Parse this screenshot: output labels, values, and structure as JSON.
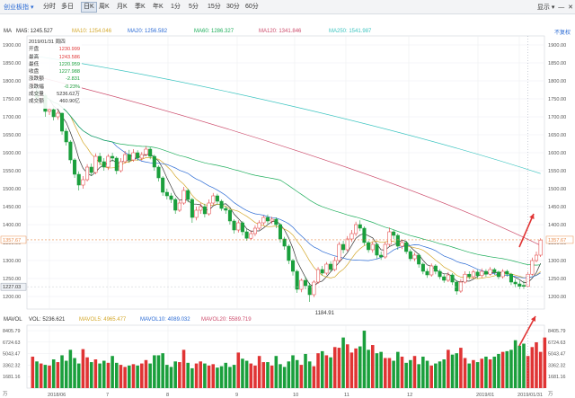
{
  "toolbar": {
    "title": "创业板指",
    "periods": [
      "分时",
      "多日",
      "日K",
      "周K",
      "月K",
      "季K",
      "年K",
      "1分",
      "5分",
      "15分",
      "30分",
      "60分"
    ],
    "active_period": "日K",
    "right_text": "显示",
    "right_icons": [
      "chevron-down-icon",
      "minimize-icon",
      "close-icon"
    ]
  },
  "ma_legend": [
    {
      "label": "MA5: 1245.527",
      "color": "#333333"
    },
    {
      "label": "MA10: 1254.046",
      "color": "#d4a82b"
    },
    {
      "label": "MA20: 1256.582",
      "color": "#2a6ad4"
    },
    {
      "label": "MA60: 1286.327",
      "color": "#1fae5c"
    },
    {
      "label": "MA120: 1341.846",
      "color": "#cc4b6b"
    },
    {
      "label": "MA250: 1541.987",
      "color": "#3bc4c0"
    }
  ],
  "ma_label": "MA",
  "fuquan_button": "不复权",
  "info_box": {
    "date": "2019/01/31 周四",
    "rows": [
      {
        "k": "开盘",
        "v": "1230.999",
        "c": "#e03434"
      },
      {
        "k": "最高",
        "v": "1243.586",
        "c": "#e03434"
      },
      {
        "k": "最低",
        "v": "1220.959",
        "c": "#1a9f3c"
      },
      {
        "k": "收盘",
        "v": "1227.988",
        "c": "#1a9f3c"
      },
      {
        "k": "涨跌额",
        "v": "-2.831",
        "c": "#1a9f3c"
      },
      {
        "k": "涨跌幅",
        "v": "-0.23%",
        "c": "#1a9f3c"
      },
      {
        "k": "成交量",
        "v": "5236.62万",
        "c": "#333333"
      },
      {
        "k": "成交额",
        "v": "460.90亿",
        "c": "#333333"
      }
    ]
  },
  "price_axis": {
    "ticks": [
      "1900.00",
      "1850.00",
      "1800.00",
      "1750.00",
      "1700.00",
      "1650.00",
      "1600.00",
      "1550.00",
      "1500.00",
      "1450.00",
      "1400.00",
      "1350.00",
      "1300.00",
      "1250.00",
      "1200.00"
    ],
    "left_marker": "1357.67",
    "right_marker": "1357.67",
    "left_marker2": "1227.03",
    "low_label": "1184.91"
  },
  "volume": {
    "legend": [
      {
        "label": "MAVOL",
        "color": "#333333"
      },
      {
        "label": "VOL: 5236.621",
        "color": "#333333"
      },
      {
        "label": "MAVOL5: 4965.477",
        "color": "#d4a82b"
      },
      {
        "label": "MAVOL10: 4089.032",
        "color": "#2a6ad4"
      },
      {
        "label": "MAVOL20: 5589.719",
        "color": "#cc4b6b"
      }
    ],
    "left_ticks": [
      "8405.79",
      "6724.63",
      "5043.47",
      "3362.32",
      "1681.16",
      "万"
    ],
    "right_ticks": [
      "8405.79",
      "6724.63",
      "5043.47",
      "3362.32",
      "1681.16",
      "万"
    ]
  },
  "x_axis": {
    "labels": [
      "2018/06",
      "7",
      "8",
      "9",
      "10",
      "11",
      "12",
      "2019/01",
      "2019/01/31"
    ]
  },
  "colors": {
    "up": "#e03434",
    "down": "#1a9f3c",
    "accent": "#2a6ad4",
    "arrow": "#e03434"
  },
  "chart_data": {
    "type": "candlestick",
    "ylim": [
      1175,
      1920
    ],
    "candles": [
      {
        "o": 1790,
        "c": 1795,
        "h": 1805,
        "l": 1775
      },
      {
        "o": 1770,
        "c": 1752,
        "h": 1780,
        "l": 1740
      },
      {
        "o": 1752,
        "c": 1760,
        "h": 1770,
        "l": 1745
      },
      {
        "o": 1760,
        "c": 1715,
        "h": 1765,
        "l": 1700
      },
      {
        "o": 1715,
        "c": 1720,
        "h": 1730,
        "l": 1705
      },
      {
        "o": 1720,
        "c": 1700,
        "h": 1728,
        "l": 1690
      },
      {
        "o": 1700,
        "c": 1710,
        "h": 1718,
        "l": 1692
      },
      {
        "o": 1710,
        "c": 1660,
        "h": 1712,
        "l": 1650
      },
      {
        "o": 1660,
        "c": 1630,
        "h": 1668,
        "l": 1620
      },
      {
        "o": 1630,
        "c": 1580,
        "h": 1635,
        "l": 1570
      },
      {
        "o": 1580,
        "c": 1540,
        "h": 1585,
        "l": 1530
      },
      {
        "o": 1540,
        "c": 1510,
        "h": 1548,
        "l": 1495
      },
      {
        "o": 1510,
        "c": 1525,
        "h": 1535,
        "l": 1500
      },
      {
        "o": 1525,
        "c": 1560,
        "h": 1568,
        "l": 1520
      },
      {
        "o": 1560,
        "c": 1545,
        "h": 1570,
        "l": 1535
      },
      {
        "o": 1545,
        "c": 1590,
        "h": 1598,
        "l": 1540
      },
      {
        "o": 1590,
        "c": 1575,
        "h": 1600,
        "l": 1565
      },
      {
        "o": 1575,
        "c": 1560,
        "h": 1585,
        "l": 1550
      },
      {
        "o": 1560,
        "c": 1590,
        "h": 1596,
        "l": 1552
      },
      {
        "o": 1590,
        "c": 1585,
        "h": 1600,
        "l": 1575
      },
      {
        "o": 1585,
        "c": 1550,
        "h": 1590,
        "l": 1540
      },
      {
        "o": 1550,
        "c": 1575,
        "h": 1585,
        "l": 1545
      },
      {
        "o": 1575,
        "c": 1595,
        "h": 1605,
        "l": 1570
      },
      {
        "o": 1595,
        "c": 1580,
        "h": 1608,
        "l": 1572
      },
      {
        "o": 1580,
        "c": 1600,
        "h": 1610,
        "l": 1575
      },
      {
        "o": 1600,
        "c": 1585,
        "h": 1607,
        "l": 1578
      },
      {
        "o": 1585,
        "c": 1595,
        "h": 1602,
        "l": 1578
      },
      {
        "o": 1595,
        "c": 1610,
        "h": 1618,
        "l": 1590
      },
      {
        "o": 1610,
        "c": 1590,
        "h": 1615,
        "l": 1582
      },
      {
        "o": 1590,
        "c": 1560,
        "h": 1595,
        "l": 1550
      },
      {
        "o": 1560,
        "c": 1530,
        "h": 1565,
        "l": 1520
      },
      {
        "o": 1530,
        "c": 1490,
        "h": 1535,
        "l": 1480
      },
      {
        "o": 1490,
        "c": 1480,
        "h": 1500,
        "l": 1470
      },
      {
        "o": 1480,
        "c": 1470,
        "h": 1488,
        "l": 1460
      },
      {
        "o": 1470,
        "c": 1440,
        "h": 1475,
        "l": 1430
      },
      {
        "o": 1440,
        "c": 1460,
        "h": 1470,
        "l": 1435
      },
      {
        "o": 1460,
        "c": 1495,
        "h": 1505,
        "l": 1455
      },
      {
        "o": 1495,
        "c": 1470,
        "h": 1500,
        "l": 1462
      },
      {
        "o": 1470,
        "c": 1420,
        "h": 1475,
        "l": 1405
      },
      {
        "o": 1420,
        "c": 1440,
        "h": 1450,
        "l": 1412
      },
      {
        "o": 1440,
        "c": 1450,
        "h": 1460,
        "l": 1430
      },
      {
        "o": 1450,
        "c": 1430,
        "h": 1458,
        "l": 1420
      },
      {
        "o": 1430,
        "c": 1460,
        "h": 1470,
        "l": 1425
      },
      {
        "o": 1460,
        "c": 1480,
        "h": 1488,
        "l": 1455
      },
      {
        "o": 1480,
        "c": 1465,
        "h": 1486,
        "l": 1455
      },
      {
        "o": 1465,
        "c": 1445,
        "h": 1470,
        "l": 1438
      },
      {
        "o": 1445,
        "c": 1440,
        "h": 1452,
        "l": 1430
      },
      {
        "o": 1440,
        "c": 1410,
        "h": 1445,
        "l": 1400
      },
      {
        "o": 1410,
        "c": 1385,
        "h": 1415,
        "l": 1375
      },
      {
        "o": 1385,
        "c": 1405,
        "h": 1412,
        "l": 1378
      },
      {
        "o": 1405,
        "c": 1380,
        "h": 1410,
        "l": 1370
      },
      {
        "o": 1380,
        "c": 1362,
        "h": 1388,
        "l": 1355
      },
      {
        "o": 1362,
        "c": 1375,
        "h": 1384,
        "l": 1358
      },
      {
        "o": 1375,
        "c": 1390,
        "h": 1398,
        "l": 1368
      },
      {
        "o": 1390,
        "c": 1405,
        "h": 1412,
        "l": 1385
      },
      {
        "o": 1405,
        "c": 1420,
        "h": 1425,
        "l": 1398
      },
      {
        "o": 1420,
        "c": 1410,
        "h": 1428,
        "l": 1402
      },
      {
        "o": 1410,
        "c": 1415,
        "h": 1422,
        "l": 1402
      },
      {
        "o": 1415,
        "c": 1400,
        "h": 1420,
        "l": 1390
      },
      {
        "o": 1400,
        "c": 1360,
        "h": 1403,
        "l": 1350
      },
      {
        "o": 1360,
        "c": 1340,
        "h": 1366,
        "l": 1330
      },
      {
        "o": 1340,
        "c": 1300,
        "h": 1345,
        "l": 1290
      },
      {
        "o": 1300,
        "c": 1270,
        "h": 1305,
        "l": 1258
      },
      {
        "o": 1270,
        "c": 1220,
        "h": 1275,
        "l": 1210
      },
      {
        "o": 1220,
        "c": 1245,
        "h": 1250,
        "l": 1212
      },
      {
        "o": 1245,
        "c": 1230,
        "h": 1255,
        "l": 1220
      },
      {
        "o": 1230,
        "c": 1205,
        "h": 1238,
        "l": 1185
      },
      {
        "o": 1205,
        "c": 1240,
        "h": 1245,
        "l": 1198
      },
      {
        "o": 1240,
        "c": 1275,
        "h": 1282,
        "l": 1235
      },
      {
        "o": 1275,
        "c": 1265,
        "h": 1285,
        "l": 1258
      },
      {
        "o": 1265,
        "c": 1290,
        "h": 1296,
        "l": 1260
      },
      {
        "o": 1290,
        "c": 1275,
        "h": 1298,
        "l": 1270
      },
      {
        "o": 1275,
        "c": 1300,
        "h": 1310,
        "l": 1270
      },
      {
        "o": 1300,
        "c": 1345,
        "h": 1352,
        "l": 1295
      },
      {
        "o": 1345,
        "c": 1330,
        "h": 1355,
        "l": 1320
      },
      {
        "o": 1330,
        "c": 1360,
        "h": 1368,
        "l": 1325
      },
      {
        "o": 1360,
        "c": 1375,
        "h": 1385,
        "l": 1352
      },
      {
        "o": 1375,
        "c": 1400,
        "h": 1408,
        "l": 1368
      },
      {
        "o": 1400,
        "c": 1390,
        "h": 1412,
        "l": 1382
      },
      {
        "o": 1390,
        "c": 1350,
        "h": 1395,
        "l": 1342
      },
      {
        "o": 1350,
        "c": 1330,
        "h": 1355,
        "l": 1322
      },
      {
        "o": 1330,
        "c": 1345,
        "h": 1352,
        "l": 1322
      },
      {
        "o": 1345,
        "c": 1315,
        "h": 1350,
        "l": 1305
      },
      {
        "o": 1315,
        "c": 1310,
        "h": 1325,
        "l": 1302
      },
      {
        "o": 1310,
        "c": 1345,
        "h": 1352,
        "l": 1305
      },
      {
        "o": 1345,
        "c": 1380,
        "h": 1392,
        "l": 1340
      },
      {
        "o": 1380,
        "c": 1370,
        "h": 1385,
        "l": 1360
      },
      {
        "o": 1370,
        "c": 1340,
        "h": 1375,
        "l": 1330
      },
      {
        "o": 1340,
        "c": 1350,
        "h": 1358,
        "l": 1332
      },
      {
        "o": 1350,
        "c": 1325,
        "h": 1355,
        "l": 1318
      },
      {
        "o": 1325,
        "c": 1305,
        "h": 1332,
        "l": 1298
      },
      {
        "o": 1305,
        "c": 1315,
        "h": 1322,
        "l": 1298
      },
      {
        "o": 1315,
        "c": 1290,
        "h": 1320,
        "l": 1280
      },
      {
        "o": 1290,
        "c": 1270,
        "h": 1295,
        "l": 1262
      },
      {
        "o": 1270,
        "c": 1260,
        "h": 1278,
        "l": 1252
      },
      {
        "o": 1260,
        "c": 1285,
        "h": 1292,
        "l": 1255
      },
      {
        "o": 1285,
        "c": 1270,
        "h": 1290,
        "l": 1262
      },
      {
        "o": 1270,
        "c": 1255,
        "h": 1276,
        "l": 1248
      },
      {
        "o": 1255,
        "c": 1245,
        "h": 1262,
        "l": 1238
      },
      {
        "o": 1245,
        "c": 1260,
        "h": 1268,
        "l": 1240
      },
      {
        "o": 1260,
        "c": 1240,
        "h": 1265,
        "l": 1232
      },
      {
        "o": 1240,
        "c": 1215,
        "h": 1245,
        "l": 1205
      },
      {
        "o": 1215,
        "c": 1240,
        "h": 1248,
        "l": 1210
      },
      {
        "o": 1240,
        "c": 1262,
        "h": 1270,
        "l": 1236
      },
      {
        "o": 1262,
        "c": 1255,
        "h": 1270,
        "l": 1248
      },
      {
        "o": 1255,
        "c": 1268,
        "h": 1275,
        "l": 1250
      },
      {
        "o": 1268,
        "c": 1258,
        "h": 1274,
        "l": 1250
      },
      {
        "o": 1258,
        "c": 1270,
        "h": 1278,
        "l": 1252
      },
      {
        "o": 1270,
        "c": 1262,
        "h": 1276,
        "l": 1255
      },
      {
        "o": 1262,
        "c": 1275,
        "h": 1282,
        "l": 1258
      },
      {
        "o": 1275,
        "c": 1268,
        "h": 1280,
        "l": 1260
      },
      {
        "o": 1268,
        "c": 1255,
        "h": 1272,
        "l": 1248
      },
      {
        "o": 1255,
        "c": 1270,
        "h": 1276,
        "l": 1250
      },
      {
        "o": 1270,
        "c": 1262,
        "h": 1275,
        "l": 1255
      },
      {
        "o": 1262,
        "c": 1240,
        "h": 1266,
        "l": 1232
      },
      {
        "o": 1240,
        "c": 1235,
        "h": 1248,
        "l": 1226
      },
      {
        "o": 1235,
        "c": 1228,
        "h": 1244,
        "l": 1221
      },
      {
        "o": 1231,
        "c": 1228,
        "h": 1244,
        "l": 1221
      },
      {
        "o": 1228,
        "c": 1262,
        "h": 1268,
        "l": 1225
      },
      {
        "o": 1262,
        "c": 1300,
        "h": 1308,
        "l": 1258
      },
      {
        "o": 1300,
        "c": 1315,
        "h": 1325,
        "l": 1295
      },
      {
        "o": 1315,
        "c": 1357,
        "h": 1362,
        "l": 1310
      }
    ],
    "volumes": [
      4600,
      3900,
      3600,
      3400,
      3300,
      4200,
      3800,
      4800,
      4000,
      5600,
      4400,
      3600,
      5700,
      4500,
      3800,
      4200,
      3600,
      4000,
      3700,
      4700,
      3700,
      3400,
      3100,
      3300,
      3500,
      3300,
      3600,
      4100,
      3600,
      4800,
      4800,
      5100,
      3400,
      3100,
      3900,
      3800,
      5600,
      3700,
      2900,
      3600,
      3900,
      3600,
      3300,
      3500,
      3000,
      3200,
      3700,
      3100,
      3400,
      5200,
      4300,
      4000,
      3600,
      3300,
      4700,
      3800,
      3800,
      3300,
      4700,
      3500,
      3100,
      3900,
      4800,
      4100,
      3400,
      5000,
      3900,
      3200,
      5100,
      5400,
      4800,
      4500,
      6000,
      5900,
      7400,
      6400,
      5200,
      5800,
      6100,
      8400,
      5600,
      6300,
      5100,
      5300,
      4400,
      4400,
      4000,
      5300,
      4600,
      3700,
      4100,
      4700,
      3500,
      4600,
      4000,
      3300,
      3600,
      3900,
      4200,
      5600,
      4900,
      5100,
      5900,
      4400,
      3600,
      4100,
      3800,
      4300,
      4600,
      4200,
      4600,
      5000,
      5300,
      5400,
      5600,
      7000,
      6200,
      6500,
      4700,
      6000,
      6700,
      5300,
      7400
    ]
  }
}
